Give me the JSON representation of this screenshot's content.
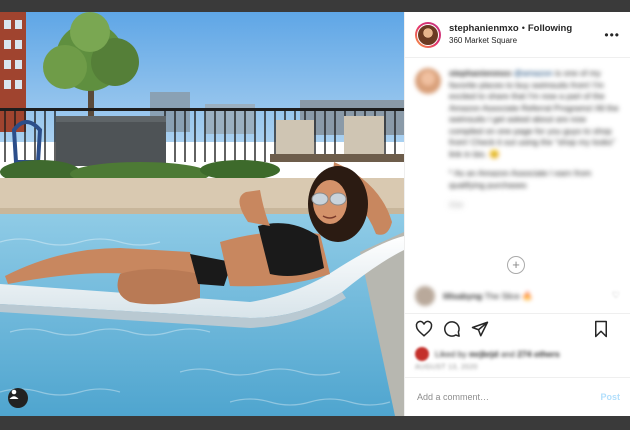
{
  "post": {
    "username": "stephanienmxo",
    "follow_status": "Following",
    "location": "360 Market Square"
  },
  "caption": {
    "username": "stephanienmxo",
    "mention": "@amazon",
    "text_1": "is one of my favorite places to buy swimsuits from! I'm excited to share that I'm now a part of the Amazon Associate Referral Programs! All the swimsuits I get asked about are now compiled on one page for you guys to shop from! Check it out using the \"shop my looks\" link in bio. 😊",
    "text_2": "* As an Amazon Associate I earn from qualifying purchases",
    "time": "21w"
  },
  "comment": {
    "username": "lillsabyng",
    "text": "The Slice 🔥"
  },
  "likes": {
    "prefix": "Liked by",
    "user": "mrjbrjd",
    "suffix": "and",
    "count": "274 others"
  },
  "date": "AUGUST 13, 2020",
  "add_comment": {
    "placeholder": "Add a comment…",
    "post_label": "Post"
  },
  "icons": {
    "more": "more-options-icon",
    "like": "heart-icon",
    "comment": "comment-icon",
    "share": "paper-plane-icon",
    "save": "bookmark-icon",
    "tag": "user-tag-icon",
    "load_more": "plus-circle-icon"
  }
}
